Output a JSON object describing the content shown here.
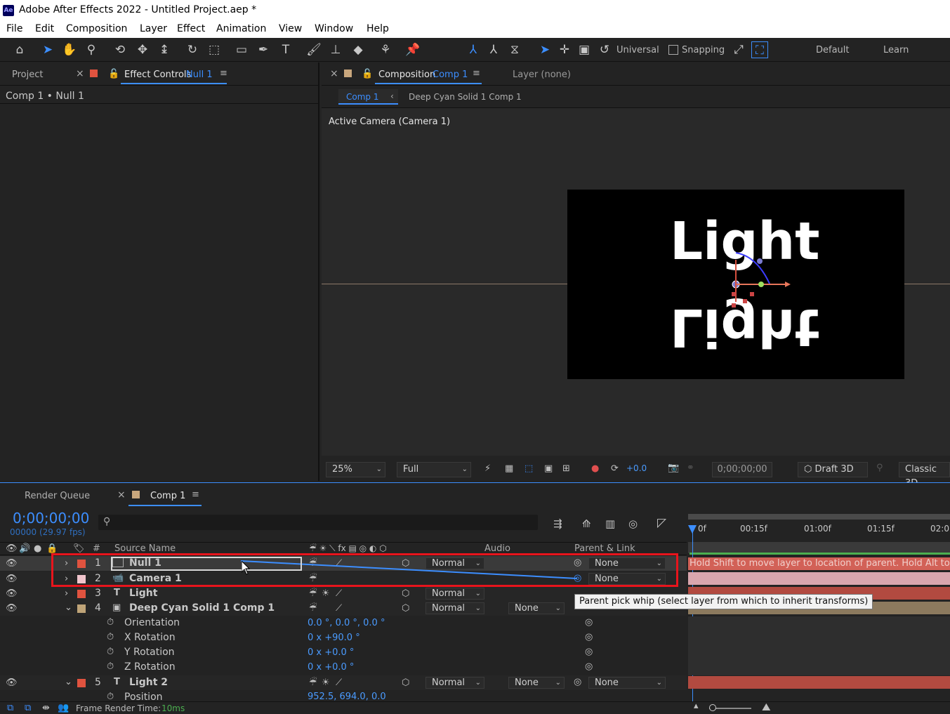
{
  "window": {
    "title": "Adobe After Effects 2022 - Untitled Project.aep *",
    "logo": "Ae"
  },
  "menu": [
    "File",
    "Edit",
    "Composition",
    "Layer",
    "Effect",
    "Animation",
    "View",
    "Window",
    "Help"
  ],
  "toolbar": {
    "axis_mode": "Universal",
    "snapping_label": "Snapping",
    "workspace_default": "Default",
    "workspace_learn": "Learn"
  },
  "left_panel": {
    "tab_project": "Project",
    "tab_effect_controls": "Effect Controls",
    "effect_target": "Null 1",
    "breadcrumb": "Comp 1 • Null 1"
  },
  "comp_panel": {
    "tab_composition": "Composition",
    "comp_name": "Comp 1",
    "layer_tab": "Layer (none)",
    "nav_comp": "Comp 1",
    "nav_sub": "Deep Cyan Solid 1 Comp 1",
    "viewer_label": "Active Camera (Camera 1)",
    "canvas_text": "Light",
    "footer": {
      "zoom": "25%",
      "resolution": "Full",
      "exposure": "+0.0",
      "timecode": "0;00;00;00",
      "renderer": "Draft 3D",
      "renderer_mode": "Classic 3D"
    }
  },
  "timeline": {
    "tab_render_queue": "Render Queue",
    "tab_comp": "Comp 1",
    "timecode": "0;00;00;00",
    "fps": "00000 (29.97 fps)",
    "headers": {
      "num": "#",
      "source_name": "Source Name",
      "audio": "Audio",
      "parent": "Parent & Link"
    },
    "ruler": [
      "0f",
      "00:15f",
      "01:00f",
      "01:15f",
      "02:0"
    ],
    "layers": [
      {
        "num": "1",
        "name": "Null 1",
        "mode": "Normal",
        "parent": "None",
        "color": "#e0533f"
      },
      {
        "num": "2",
        "name": "Camera 1",
        "parent": "None",
        "color": "#f0c4cc"
      },
      {
        "num": "3",
        "name": "Light",
        "mode": "Normal",
        "color": "#e0533f"
      },
      {
        "num": "4",
        "name": "Deep Cyan Solid 1 Comp 1",
        "mode": "Normal",
        "trkmat": "None",
        "color": "#bfa478"
      },
      {
        "num": "5",
        "name": "Light 2",
        "mode": "Normal",
        "trkmat": "None",
        "parent": "None",
        "color": "#e0533f"
      }
    ],
    "props": [
      {
        "name": "Orientation",
        "value": "0.0 °, 0.0 °, 0.0 °"
      },
      {
        "name": "X Rotation",
        "value": "0 x +90.0 °"
      },
      {
        "name": "Y Rotation",
        "value": "0 x +0.0 °"
      },
      {
        "name": "Z Rotation",
        "value": "0 x +0.0 °"
      },
      {
        "name": "Position",
        "value": "952.5, 694.0, 0.0"
      }
    ],
    "hint": "Hold Shift to move layer to location of parent. Hold Alt to m",
    "tooltip": "Parent pick whip (select layer from which to inherit transforms)",
    "footer_label": "Frame Render Time:",
    "footer_value": "10ms"
  },
  "colors": {
    "accent": "#3c8eff",
    "highlight_red": "#e8141c",
    "bg": "#232323"
  }
}
